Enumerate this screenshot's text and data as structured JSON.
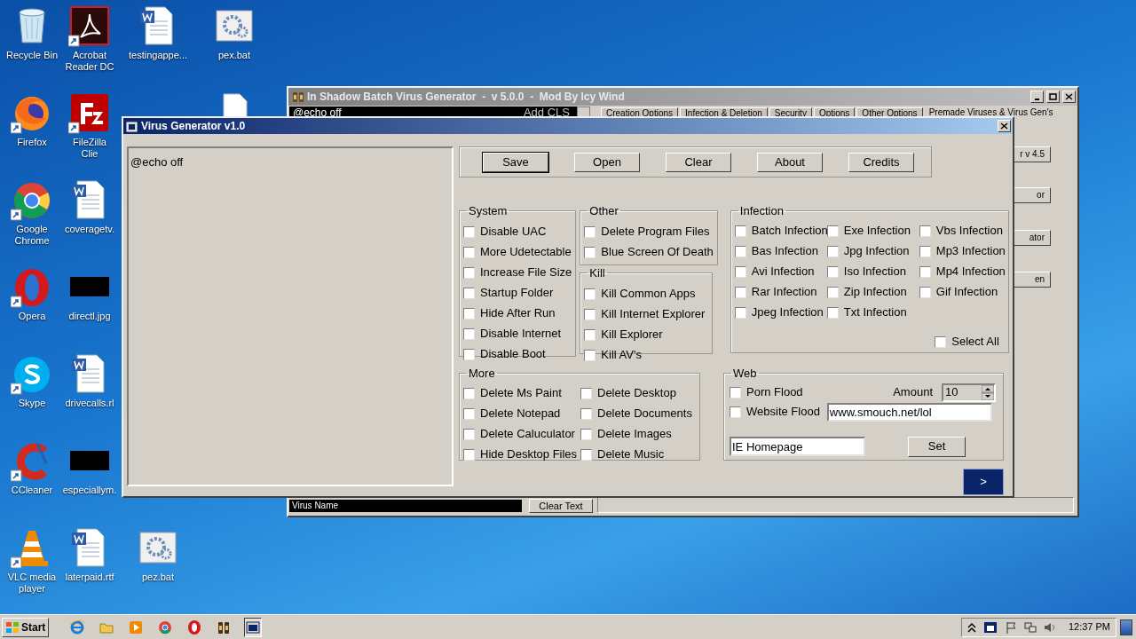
{
  "desktop": {
    "columns": [
      [
        {
          "kind": "recycle",
          "label": "Recycle Bin",
          "shortcut": false
        },
        {
          "kind": "firefox",
          "label": "Firefox",
          "shortcut": true
        },
        {
          "kind": "chrome",
          "label": "Google Chrome",
          "shortcut": true
        },
        {
          "kind": "opera",
          "label": "Opera",
          "shortcut": true
        },
        {
          "kind": "skype",
          "label": "Skype",
          "shortcut": true
        },
        {
          "kind": "ccleaner",
          "label": "CCleaner",
          "shortcut": true
        },
        {
          "kind": "vlc",
          "label": "VLC media player",
          "shortcut": true
        }
      ],
      [
        {
          "kind": "pdf",
          "label": "Acrobat Reader DC",
          "shortcut": true
        },
        {
          "kind": "filezilla",
          "label": "FileZilla Clie",
          "shortcut": true
        },
        {
          "kind": "word",
          "label": "coveragetv.",
          "shortcut": false
        },
        {
          "kind": "image",
          "label": "directl.jpg",
          "shortcut": false
        },
        {
          "kind": "word",
          "label": "drivecalls.rl",
          "shortcut": false
        },
        {
          "kind": "image",
          "label": "especiallym.",
          "shortcut": false
        },
        {
          "kind": "word",
          "label": "laterpaid.rtf",
          "shortcut": false
        }
      ],
      [
        {
          "kind": "word",
          "label": "testingappe...",
          "shortcut": false
        },
        {
          "kind": "empty"
        },
        {
          "kind": "empty"
        },
        {
          "kind": "empty"
        },
        {
          "kind": "empty"
        },
        {
          "kind": "empty"
        },
        {
          "kind": "bat",
          "label": "pez.bat",
          "shortcut": false
        }
      ],
      [
        {
          "kind": "bat",
          "label": "pex.bat",
          "shortcut": false
        },
        {
          "kind": "file"
        }
      ]
    ]
  },
  "back_window": {
    "title": "In Shadow Batch Virus Generator  -  v 5.0.0  -  Mod By Icy Wind",
    "editor_text": "@echo off",
    "add_button": "Add CLS",
    "tabs": [
      {
        "label": "Creation Options",
        "selected": false
      },
      {
        "label": "Infection & Deletion",
        "selected": false
      },
      {
        "label": "Security",
        "selected": false
      },
      {
        "label": "Options",
        "selected": false
      },
      {
        "label": "Other Options",
        "selected": false
      },
      {
        "label": "Premade Viruses & Virus Gen's",
        "selected": true
      }
    ],
    "side_buttons": [
      "r v 4.5",
      "or",
      "ator",
      "en"
    ],
    "name_field": {
      "value": "Virus Name"
    },
    "clear_button": "Clear Text"
  },
  "window": {
    "title": "Virus Generator v1.0",
    "script_text": "@echo off",
    "toolbar": [
      {
        "label": "Save",
        "focused": true
      },
      {
        "label": "Open",
        "focused": false
      },
      {
        "label": "Clear",
        "focused": false
      },
      {
        "label": "About",
        "focused": false
      },
      {
        "label": "Credits",
        "focused": false
      }
    ],
    "system": {
      "title": "System",
      "items": [
        {
          "label": "Disable UAC",
          "checked": false
        },
        {
          "label": "More Udetectable",
          "checked": false
        },
        {
          "label": "Increase File Size",
          "checked": false
        },
        {
          "label": "Startup Folder",
          "checked": false
        },
        {
          "label": "Hide After Run",
          "checked": false
        },
        {
          "label": "Disable Internet",
          "checked": false
        },
        {
          "label": "Disable Boot",
          "checked": false
        }
      ]
    },
    "other": {
      "title": "Other",
      "items": [
        {
          "label": "Delete Program Files",
          "checked": false
        },
        {
          "label": "Blue Screen Of Death",
          "checked": false
        }
      ]
    },
    "kill": {
      "title": "Kill",
      "items": [
        {
          "label": "Kill Common Apps",
          "checked": false
        },
        {
          "label": "Kill Internet Explorer",
          "checked": false
        },
        {
          "label": "Kill Explorer",
          "checked": false
        },
        {
          "label": "Kill AV's",
          "checked": false
        }
      ]
    },
    "infection": {
      "title": "Infection",
      "items": [
        {
          "label": "Batch Infection",
          "checked": false
        },
        {
          "label": "Exe Infection",
          "checked": false
        },
        {
          "label": "Vbs Infection",
          "checked": false
        },
        {
          "label": "Bas Infection",
          "checked": false
        },
        {
          "label": "Jpg Infection",
          "checked": false
        },
        {
          "label": "Mp3 Infection",
          "checked": false
        },
        {
          "label": "Avi Infection",
          "checked": false
        },
        {
          "label": "Iso Infection",
          "checked": false
        },
        {
          "label": "Mp4 Infection",
          "checked": false
        },
        {
          "label": "Rar Infection",
          "checked": false
        },
        {
          "label": "Zip Infection",
          "checked": false
        },
        {
          "label": "Gif Infection",
          "checked": false
        },
        {
          "label": "Jpeg Infection",
          "checked": false
        },
        {
          "label": "Txt Infection",
          "checked": false
        }
      ],
      "select_all": {
        "label": "Select All",
        "checked": false
      }
    },
    "more": {
      "title": "More",
      "items": [
        {
          "label": "Delete Ms Paint",
          "checked": false
        },
        {
          "label": "Delete Desktop",
          "checked": false
        },
        {
          "label": "Delete Notepad",
          "checked": false
        },
        {
          "label": "Delete Documents",
          "checked": false
        },
        {
          "label": "Delete Caluculator",
          "checked": false
        },
        {
          "label": "Delete Images",
          "checked": false
        },
        {
          "label": "Hide Desktop Files",
          "checked": false
        },
        {
          "label": "Delete Music",
          "checked": false
        }
      ]
    },
    "web": {
      "title": "Web",
      "porn_flood": {
        "label": "Porn Flood",
        "checked": false
      },
      "website_flood": {
        "label": "Website Flood",
        "checked": false
      },
      "amount_label": "Amount",
      "amount": "10",
      "url": "www.smouch.net/lol",
      "homepage": "IE Homepage",
      "set_button": "Set"
    },
    "next_button": ">"
  },
  "taskbar": {
    "start": "Start",
    "apps": [
      {
        "kind": "ie",
        "active": false
      },
      {
        "kind": "folder",
        "active": false
      },
      {
        "kind": "media",
        "active": false
      },
      {
        "kind": "chrome",
        "active": false
      },
      {
        "kind": "opera",
        "active": false
      },
      {
        "kind": "bottles",
        "active": false
      },
      {
        "kind": "window",
        "active": true
      }
    ],
    "clock": "12:37 PM"
  }
}
